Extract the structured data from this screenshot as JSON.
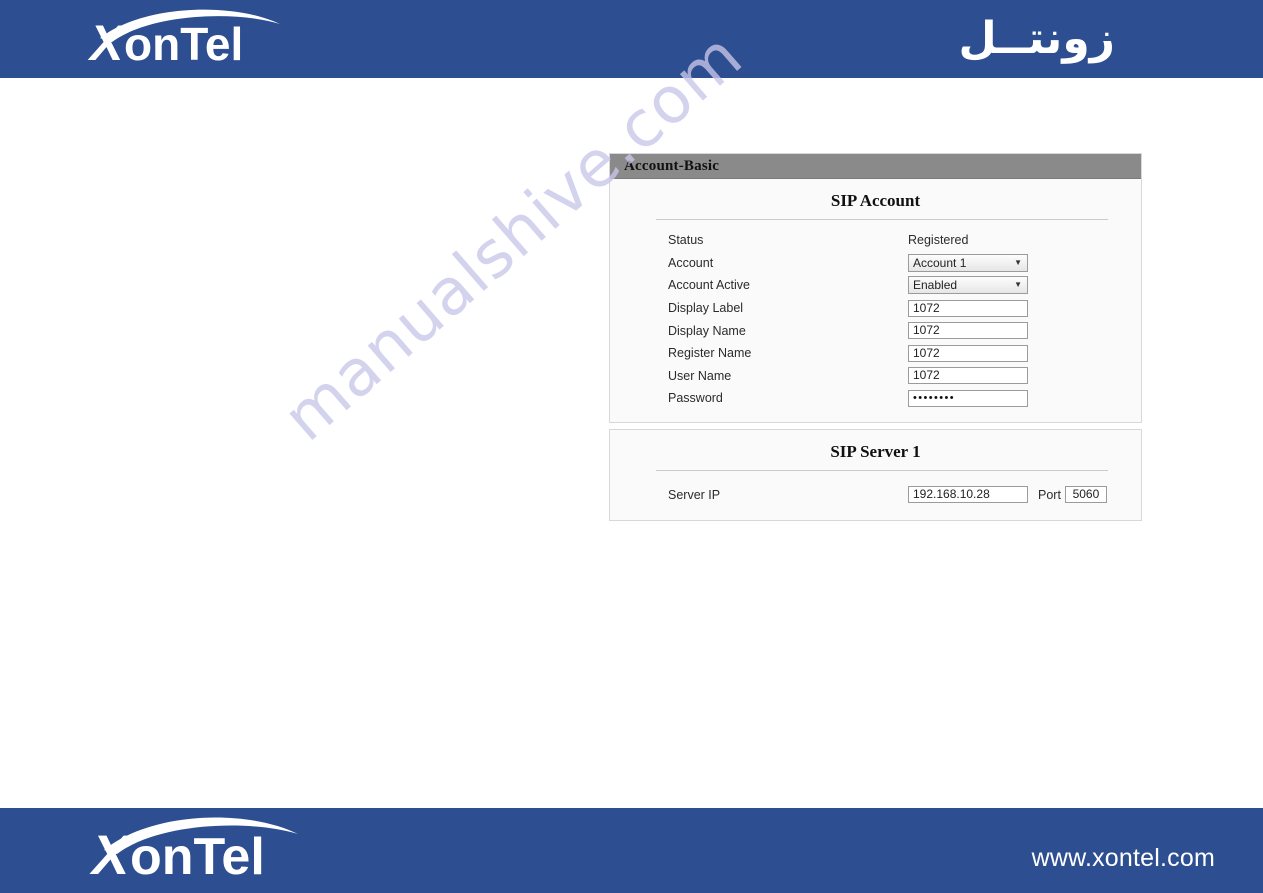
{
  "header": {
    "logo_text": "XonTel",
    "logo_icon": "xontel-swoosh-logo",
    "arabic_brand": "زونتــل"
  },
  "footer": {
    "logo_text": "XonTel",
    "logo_icon": "xontel-swoosh-logo",
    "website": "www.xontel.com"
  },
  "watermark": {
    "text": "manualshive.com"
  },
  "panels": [
    {
      "titlebar": "Account-Basic",
      "section_heading": "SIP Account",
      "rows": [
        {
          "label": "Status",
          "type": "text",
          "value": "Registered"
        },
        {
          "label": "Account",
          "type": "select",
          "value": "Account 1"
        },
        {
          "label": "Account Active",
          "type": "select",
          "value": "Enabled"
        },
        {
          "label": "Display Label",
          "type": "input",
          "value": "1072"
        },
        {
          "label": "Display Name",
          "type": "input",
          "value": "1072"
        },
        {
          "label": "Register Name",
          "type": "input",
          "value": "1072"
        },
        {
          "label": "User Name",
          "type": "input",
          "value": "1072"
        },
        {
          "label": "Password",
          "type": "password",
          "value": "••••••••"
        }
      ]
    },
    {
      "section_heading": "SIP Server 1",
      "server_row": {
        "label": "Server IP",
        "value": "192.168.10.28",
        "port_label": "Port",
        "port_value": "5060"
      }
    }
  ],
  "colors": {
    "brand_blue": "#2d4e91",
    "titlebar_gray": "#8a8a8a",
    "panel_bg": "#fafafb",
    "watermark_lavender": "#c9c7ea"
  }
}
